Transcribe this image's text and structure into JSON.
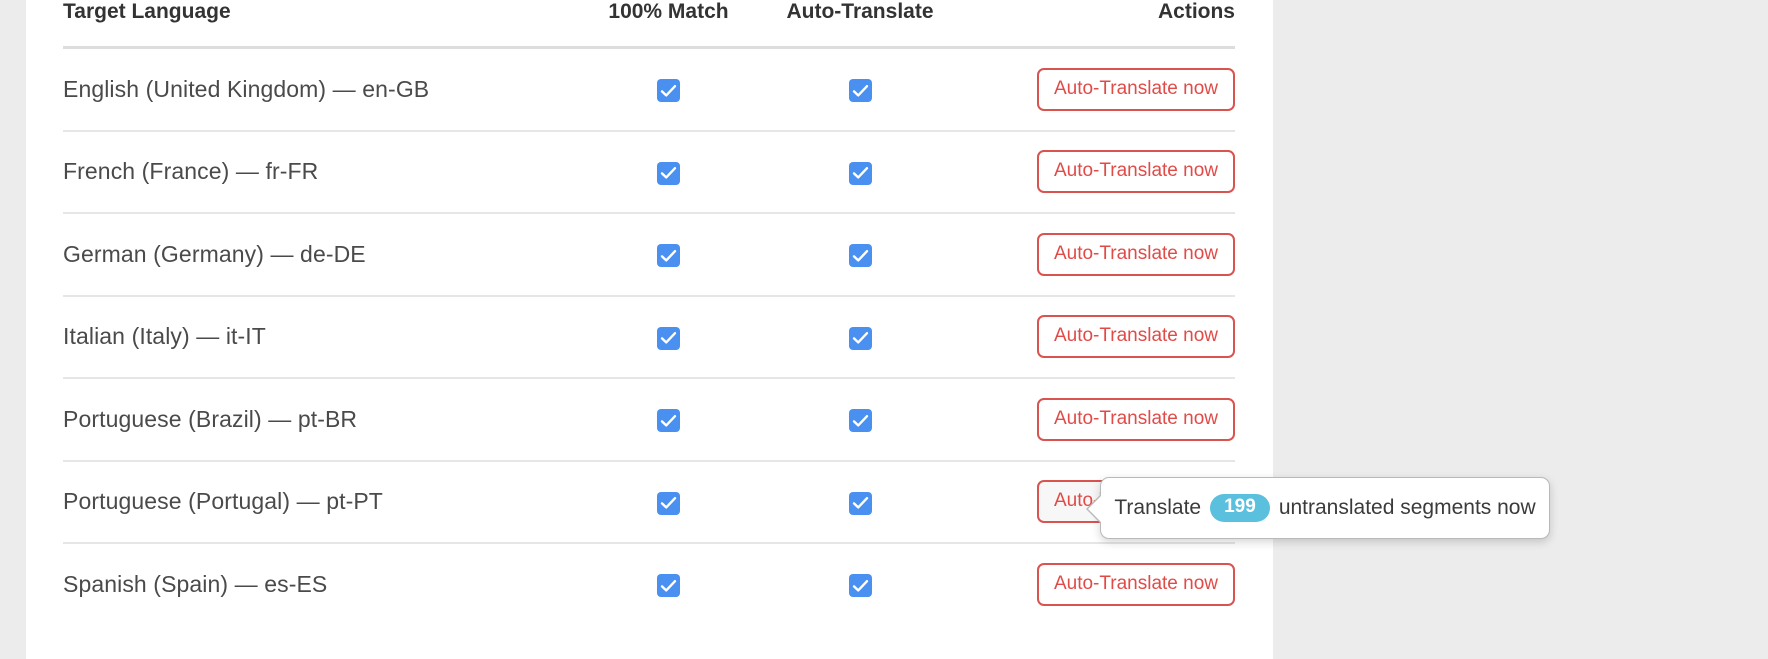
{
  "panel": {
    "background_color": "#ffffff",
    "page_background_color": "#ececec"
  },
  "table": {
    "columns": [
      {
        "key": "language",
        "label": "Target Language"
      },
      {
        "key": "match",
        "label": "100% Match"
      },
      {
        "key": "auto",
        "label": "Auto-Translate"
      },
      {
        "key": "actions",
        "label": "Actions"
      }
    ],
    "action_button_label": "Auto-Translate now",
    "rows": [
      {
        "language": "English (United Kingdom) — en-GB",
        "match_checked": true,
        "auto_checked": true,
        "action_label": "Auto-Translate now",
        "hovered": false
      },
      {
        "language": "French (France) — fr-FR",
        "match_checked": true,
        "auto_checked": true,
        "action_label": "Auto-Translate now",
        "hovered": false
      },
      {
        "language": "German (Germany) — de-DE",
        "match_checked": true,
        "auto_checked": true,
        "action_label": "Auto-Translate now",
        "hovered": false
      },
      {
        "language": "Italian (Italy) — it-IT",
        "match_checked": true,
        "auto_checked": true,
        "action_label": "Auto-Translate now",
        "hovered": false
      },
      {
        "language": "Portuguese (Brazil) — pt-BR",
        "match_checked": true,
        "auto_checked": true,
        "action_label": "Auto-Translate now",
        "hovered": false
      },
      {
        "language": "Portuguese (Portugal) — pt-PT",
        "match_checked": true,
        "auto_checked": true,
        "action_label": "Auto-Translate now",
        "hovered": true
      },
      {
        "language": "Spanish (Spain) — es-ES",
        "match_checked": true,
        "auto_checked": true,
        "action_label": "Auto-Translate now",
        "hovered": false
      }
    ]
  },
  "tooltip": {
    "text_before": "Translate",
    "count": "199",
    "text_after": "untranslated segments now",
    "badge_color": "#5bc0de",
    "attached_to_row": "Portuguese (Portugal) — pt-PT"
  },
  "icons": {
    "checkmark": "check-icon"
  },
  "colors": {
    "checkbox_blue": "#4a90f0",
    "button_red": "#d9534f",
    "button_text_red": "#e04b48",
    "badge_blue": "#5bc0de",
    "text_dark": "#333333",
    "text_body": "#4a4a4a"
  }
}
